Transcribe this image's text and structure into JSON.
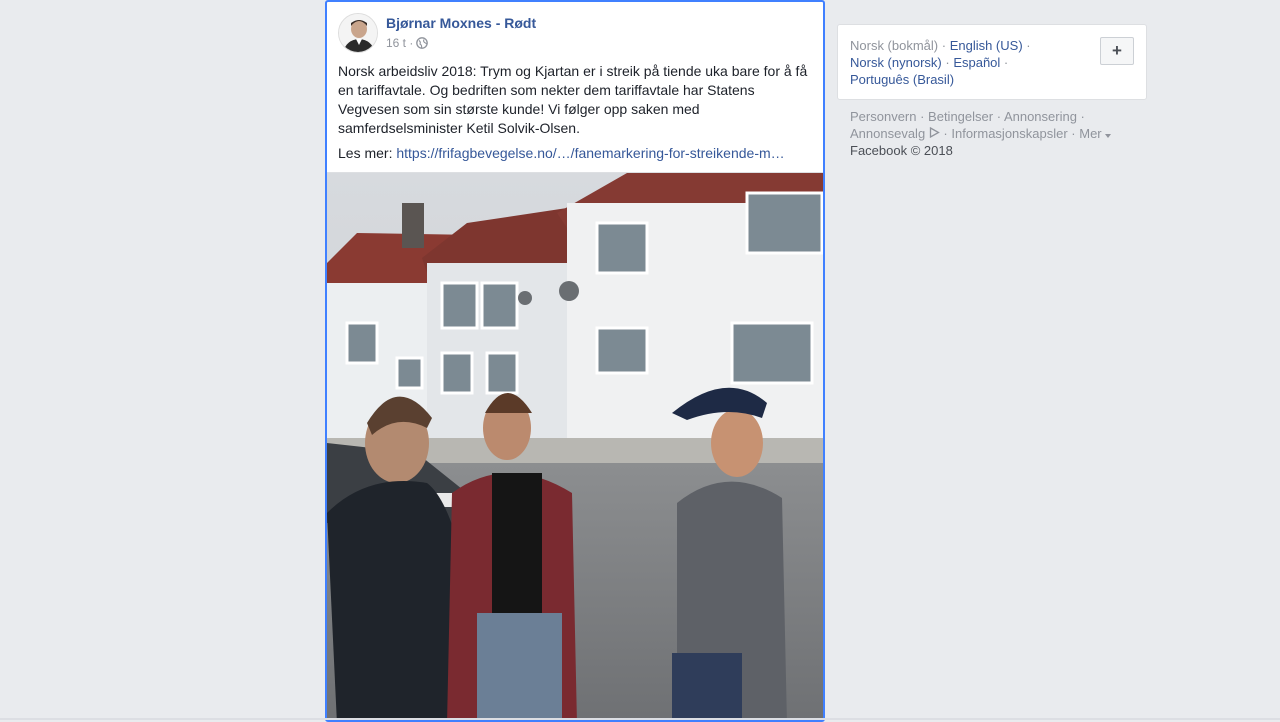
{
  "post": {
    "author": "Bjørnar Moxnes - Rødt",
    "time": "16 t ·",
    "text": "Norsk arbeidsliv 2018: Trym og Kjartan er i streik på tiende uka bare for å få en tariffavtale. Og bedriften som nekter dem tariffavtale har Statens Vegvesen som sin største kunde! Vi følger opp saken med samferdselsminister Ketil Solvik-Olsen.",
    "read_more_label": "Les mer: ",
    "read_more_url": "https://frifagbevegelse.no/…/fanemarkering-for-streikende-m…",
    "photo_alt": "",
    "privacy_icon": "globe-icon"
  },
  "languages": {
    "current": "Norsk (bokmål)",
    "items": [
      "English (US)",
      "Norsk (nynorsk)",
      "Español",
      "Português (Brasil)"
    ],
    "add_label": "+"
  },
  "footer": {
    "links": [
      "Personvern",
      "Betingelser",
      "Annonsering",
      "Annonsevalg",
      "Informasjonskapsler",
      "Mer"
    ],
    "copyright": "Facebook © 2018"
  },
  "colors": {
    "accent": "#365899",
    "focus_border": "#4080ff",
    "background": "#e9ebee"
  }
}
